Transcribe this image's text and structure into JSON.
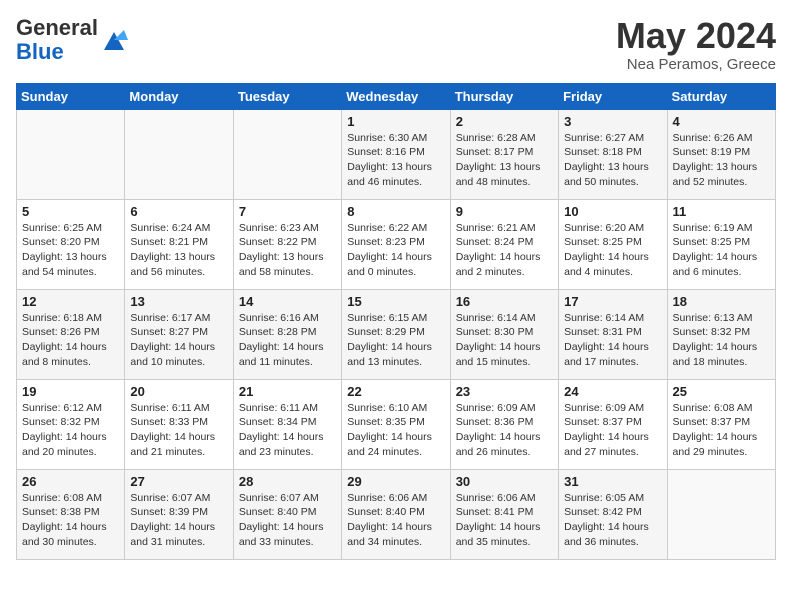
{
  "header": {
    "logo_general": "General",
    "logo_blue": "Blue",
    "month_title": "May 2024",
    "location": "Nea Peramos, Greece"
  },
  "weekdays": [
    "Sunday",
    "Monday",
    "Tuesday",
    "Wednesday",
    "Thursday",
    "Friday",
    "Saturday"
  ],
  "weeks": [
    [
      {
        "day": "",
        "info": ""
      },
      {
        "day": "",
        "info": ""
      },
      {
        "day": "",
        "info": ""
      },
      {
        "day": "1",
        "info": "Sunrise: 6:30 AM\nSunset: 8:16 PM\nDaylight: 13 hours and 46 minutes."
      },
      {
        "day": "2",
        "info": "Sunrise: 6:28 AM\nSunset: 8:17 PM\nDaylight: 13 hours and 48 minutes."
      },
      {
        "day": "3",
        "info": "Sunrise: 6:27 AM\nSunset: 8:18 PM\nDaylight: 13 hours and 50 minutes."
      },
      {
        "day": "4",
        "info": "Sunrise: 6:26 AM\nSunset: 8:19 PM\nDaylight: 13 hours and 52 minutes."
      }
    ],
    [
      {
        "day": "5",
        "info": "Sunrise: 6:25 AM\nSunset: 8:20 PM\nDaylight: 13 hours and 54 minutes."
      },
      {
        "day": "6",
        "info": "Sunrise: 6:24 AM\nSunset: 8:21 PM\nDaylight: 13 hours and 56 minutes."
      },
      {
        "day": "7",
        "info": "Sunrise: 6:23 AM\nSunset: 8:22 PM\nDaylight: 13 hours and 58 minutes."
      },
      {
        "day": "8",
        "info": "Sunrise: 6:22 AM\nSunset: 8:23 PM\nDaylight: 14 hours and 0 minutes."
      },
      {
        "day": "9",
        "info": "Sunrise: 6:21 AM\nSunset: 8:24 PM\nDaylight: 14 hours and 2 minutes."
      },
      {
        "day": "10",
        "info": "Sunrise: 6:20 AM\nSunset: 8:25 PM\nDaylight: 14 hours and 4 minutes."
      },
      {
        "day": "11",
        "info": "Sunrise: 6:19 AM\nSunset: 8:25 PM\nDaylight: 14 hours and 6 minutes."
      }
    ],
    [
      {
        "day": "12",
        "info": "Sunrise: 6:18 AM\nSunset: 8:26 PM\nDaylight: 14 hours and 8 minutes."
      },
      {
        "day": "13",
        "info": "Sunrise: 6:17 AM\nSunset: 8:27 PM\nDaylight: 14 hours and 10 minutes."
      },
      {
        "day": "14",
        "info": "Sunrise: 6:16 AM\nSunset: 8:28 PM\nDaylight: 14 hours and 11 minutes."
      },
      {
        "day": "15",
        "info": "Sunrise: 6:15 AM\nSunset: 8:29 PM\nDaylight: 14 hours and 13 minutes."
      },
      {
        "day": "16",
        "info": "Sunrise: 6:14 AM\nSunset: 8:30 PM\nDaylight: 14 hours and 15 minutes."
      },
      {
        "day": "17",
        "info": "Sunrise: 6:14 AM\nSunset: 8:31 PM\nDaylight: 14 hours and 17 minutes."
      },
      {
        "day": "18",
        "info": "Sunrise: 6:13 AM\nSunset: 8:32 PM\nDaylight: 14 hours and 18 minutes."
      }
    ],
    [
      {
        "day": "19",
        "info": "Sunrise: 6:12 AM\nSunset: 8:32 PM\nDaylight: 14 hours and 20 minutes."
      },
      {
        "day": "20",
        "info": "Sunrise: 6:11 AM\nSunset: 8:33 PM\nDaylight: 14 hours and 21 minutes."
      },
      {
        "day": "21",
        "info": "Sunrise: 6:11 AM\nSunset: 8:34 PM\nDaylight: 14 hours and 23 minutes."
      },
      {
        "day": "22",
        "info": "Sunrise: 6:10 AM\nSunset: 8:35 PM\nDaylight: 14 hours and 24 minutes."
      },
      {
        "day": "23",
        "info": "Sunrise: 6:09 AM\nSunset: 8:36 PM\nDaylight: 14 hours and 26 minutes."
      },
      {
        "day": "24",
        "info": "Sunrise: 6:09 AM\nSunset: 8:37 PM\nDaylight: 14 hours and 27 minutes."
      },
      {
        "day": "25",
        "info": "Sunrise: 6:08 AM\nSunset: 8:37 PM\nDaylight: 14 hours and 29 minutes."
      }
    ],
    [
      {
        "day": "26",
        "info": "Sunrise: 6:08 AM\nSunset: 8:38 PM\nDaylight: 14 hours and 30 minutes."
      },
      {
        "day": "27",
        "info": "Sunrise: 6:07 AM\nSunset: 8:39 PM\nDaylight: 14 hours and 31 minutes."
      },
      {
        "day": "28",
        "info": "Sunrise: 6:07 AM\nSunset: 8:40 PM\nDaylight: 14 hours and 33 minutes."
      },
      {
        "day": "29",
        "info": "Sunrise: 6:06 AM\nSunset: 8:40 PM\nDaylight: 14 hours and 34 minutes."
      },
      {
        "day": "30",
        "info": "Sunrise: 6:06 AM\nSunset: 8:41 PM\nDaylight: 14 hours and 35 minutes."
      },
      {
        "day": "31",
        "info": "Sunrise: 6:05 AM\nSunset: 8:42 PM\nDaylight: 14 hours and 36 minutes."
      },
      {
        "day": "",
        "info": ""
      }
    ]
  ]
}
